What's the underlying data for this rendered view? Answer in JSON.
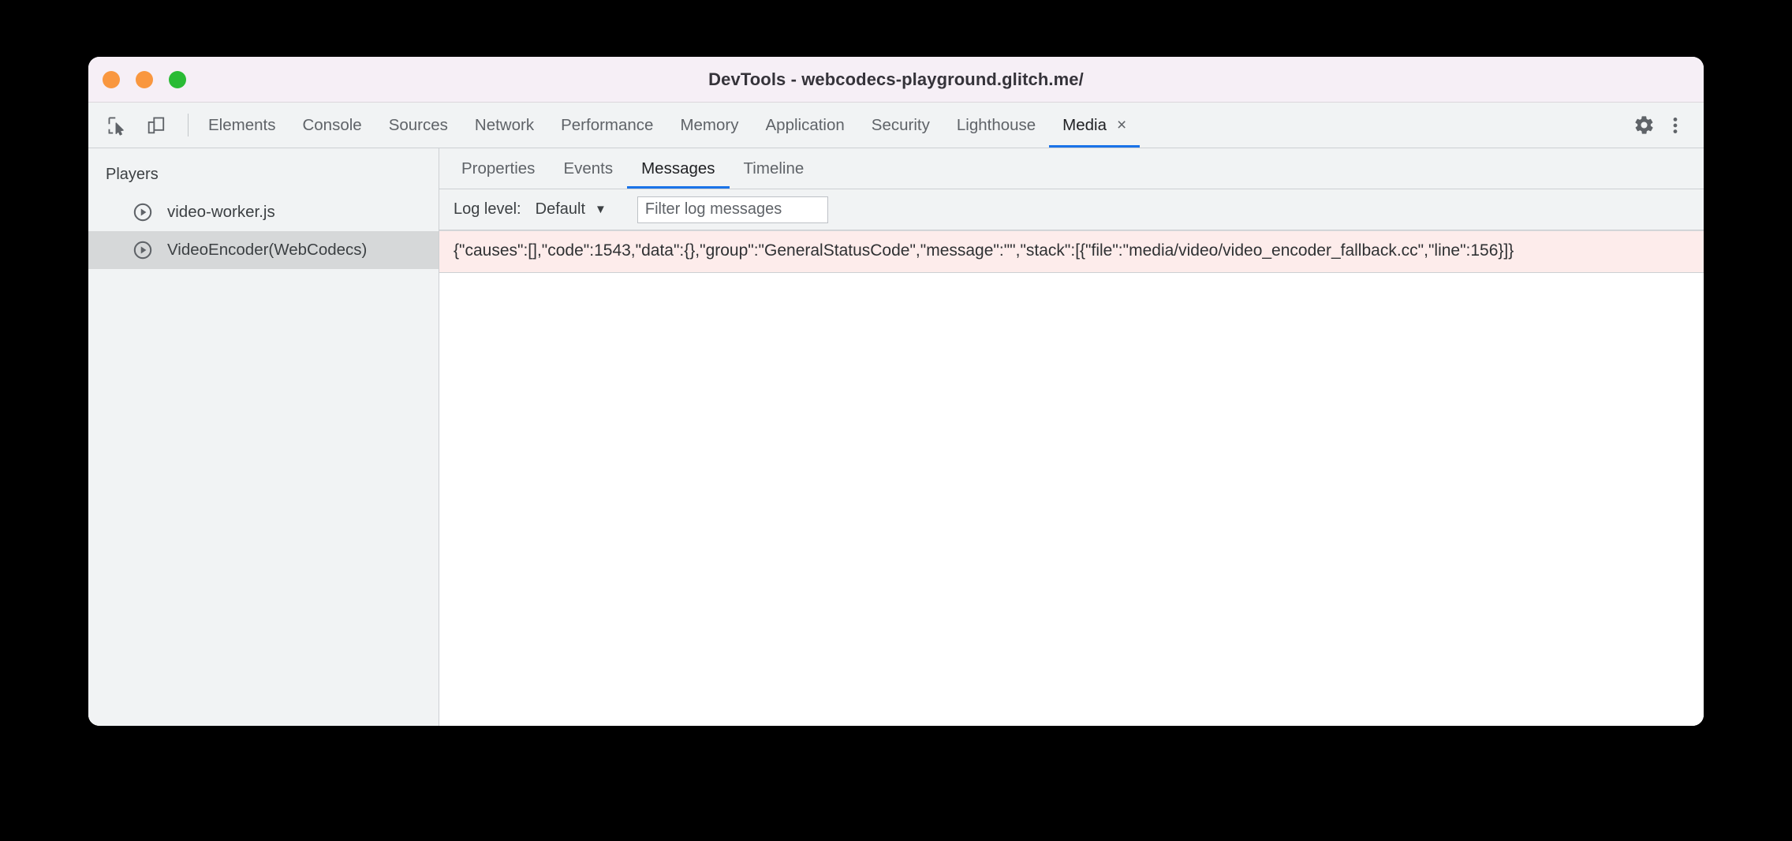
{
  "window": {
    "title": "DevTools - webcodecs-playground.glitch.me/",
    "traffic_lights": {
      "close_color": "#f9973f",
      "minimize_color": "#f9973f",
      "maximize_color": "#2abb35"
    }
  },
  "toolbar": {
    "inspect_icon": "inspect-element-icon",
    "device_icon": "device-toolbar-icon",
    "settings_icon": "gear-icon",
    "more_icon": "kebab-menu-icon",
    "accent_color": "#1a73e8"
  },
  "main_tabs": [
    {
      "label": "Elements",
      "active": false
    },
    {
      "label": "Console",
      "active": false
    },
    {
      "label": "Sources",
      "active": false
    },
    {
      "label": "Network",
      "active": false
    },
    {
      "label": "Performance",
      "active": false
    },
    {
      "label": "Memory",
      "active": false
    },
    {
      "label": "Application",
      "active": false
    },
    {
      "label": "Security",
      "active": false
    },
    {
      "label": "Lighthouse",
      "active": false
    },
    {
      "label": "Media",
      "active": true,
      "close_label": "×"
    }
  ],
  "sidebar": {
    "heading": "Players",
    "items": [
      {
        "label": "video-worker.js",
        "selected": false,
        "icon": "play-circle-icon"
      },
      {
        "label": "VideoEncoder(WebCodecs)",
        "selected": true,
        "icon": "play-circle-icon"
      }
    ]
  },
  "sub_tabs": [
    {
      "label": "Properties",
      "active": false
    },
    {
      "label": "Events",
      "active": false
    },
    {
      "label": "Messages",
      "active": true
    },
    {
      "label": "Timeline",
      "active": false
    }
  ],
  "log_toolbar": {
    "log_level_label": "Log level:",
    "log_level_value": "Default",
    "caret": "▼",
    "filter_placeholder": "Filter log messages",
    "filter_value": ""
  },
  "messages": [
    {
      "level": "error",
      "background": "#fdeceb",
      "text": "{\"causes\":[],\"code\":1543,\"data\":{},\"group\":\"GeneralStatusCode\",\"message\":\"\",\"stack\":[{\"file\":\"media/video/video_encoder_fallback.cc\",\"line\":156}]}"
    }
  ]
}
